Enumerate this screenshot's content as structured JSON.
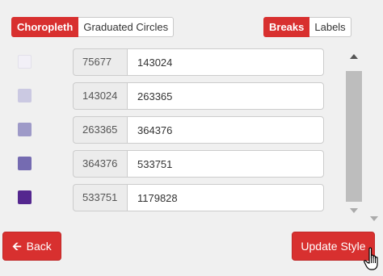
{
  "tabs": {
    "choropleth": "Choropleth",
    "graduated": "Graduated Circles"
  },
  "mode": {
    "breaks": "Breaks",
    "labels": "Labels"
  },
  "classes": [
    {
      "color": "#f2f0f7",
      "lower": "75677",
      "upper": "143024"
    },
    {
      "color": "#cbc9e2",
      "lower": "143024",
      "upper": "263365"
    },
    {
      "color": "#9e9ac8",
      "lower": "263365",
      "upper": "364376"
    },
    {
      "color": "#756bb1",
      "lower": "364376",
      "upper": "533751"
    },
    {
      "color": "#54278f",
      "lower": "533751",
      "upper": "1179828"
    }
  ],
  "buttons": {
    "back": "Back",
    "back_icon": "arrow-left-icon",
    "update": "Update Style"
  },
  "accent_color": "#d8302f"
}
